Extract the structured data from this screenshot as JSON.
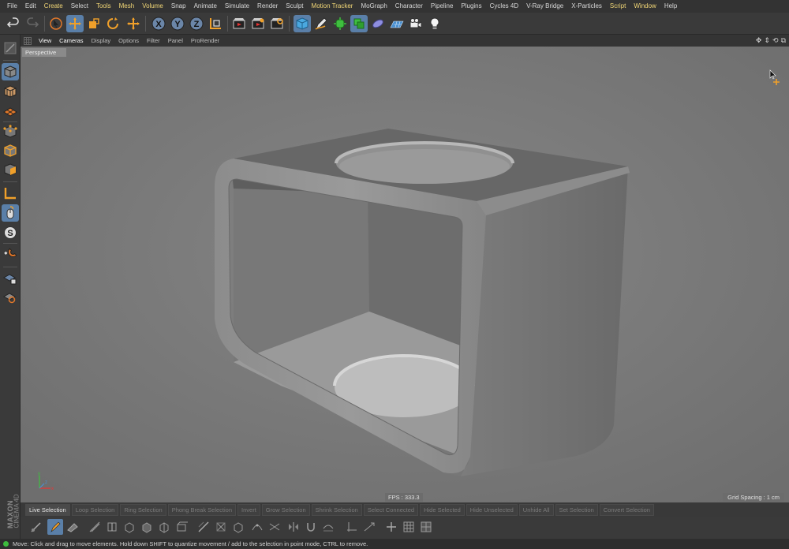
{
  "menu": {
    "items": [
      {
        "label": "File",
        "hl": false
      },
      {
        "label": "Edit",
        "hl": false
      },
      {
        "label": "Create",
        "hl": true
      },
      {
        "label": "Select",
        "hl": false
      },
      {
        "label": "Tools",
        "hl": true
      },
      {
        "label": "Mesh",
        "hl": true
      },
      {
        "label": "Volume",
        "hl": true
      },
      {
        "label": "Snap",
        "hl": false
      },
      {
        "label": "Animate",
        "hl": false
      },
      {
        "label": "Simulate",
        "hl": false
      },
      {
        "label": "Render",
        "hl": false
      },
      {
        "label": "Sculpt",
        "hl": false
      },
      {
        "label": "Motion Tracker",
        "hl": true
      },
      {
        "label": "MoGraph",
        "hl": false
      },
      {
        "label": "Character",
        "hl": false
      },
      {
        "label": "Pipeline",
        "hl": false
      },
      {
        "label": "Plugins",
        "hl": false
      },
      {
        "label": "Cycles 4D",
        "hl": false
      },
      {
        "label": "V-Ray Bridge",
        "hl": false
      },
      {
        "label": "X-Particles",
        "hl": false
      },
      {
        "label": "Script",
        "hl": true
      },
      {
        "label": "Window",
        "hl": true
      },
      {
        "label": "Help",
        "hl": false
      }
    ]
  },
  "viewport_menu": {
    "items": [
      "View",
      "Cameras",
      "Display",
      "Options",
      "Filter",
      "Panel",
      "ProRender"
    ],
    "active": [
      "View",
      "Cameras"
    ]
  },
  "viewport": {
    "label": "Perspective",
    "fps": "FPS : 333.3",
    "grid_spacing": "Grid Spacing : 1 cm"
  },
  "modes": [
    {
      "label": "Live Selection",
      "active": true
    },
    {
      "label": "Loop Selection",
      "active": false
    },
    {
      "label": "Ring Selection",
      "active": false
    },
    {
      "label": "Phong Break Selection",
      "active": false
    },
    {
      "label": "Invert",
      "active": false
    },
    {
      "label": "Grow Selection",
      "active": false
    },
    {
      "label": "Shrink Selection",
      "active": false
    },
    {
      "label": "Select Connected",
      "active": false
    },
    {
      "label": "Hide Selected",
      "active": false
    },
    {
      "label": "Hide Unselected",
      "active": false
    },
    {
      "label": "Unhide All",
      "active": false
    },
    {
      "label": "Set Selection",
      "active": false
    },
    {
      "label": "Convert Selection",
      "active": false
    }
  ],
  "brand": {
    "line1": "MAXON",
    "line2": "CINEMA 4D"
  },
  "status": {
    "text": "Move: Click and drag to move elements. Hold down SHIFT to quantize movement / add to the selection in point mode, CTRL to remove."
  },
  "toolbar_icons": [
    "undo-icon",
    "redo-icon",
    "live-selection-icon",
    "move-icon",
    "scale-icon",
    "rotate-icon",
    "recent-tool-icon",
    "x-axis-icon",
    "y-axis-icon",
    "z-axis-icon",
    "coordinate-system-icon",
    "render-view-icon",
    "render-picture-viewer-icon",
    "edit-render-settings-icon",
    "cube-icon",
    "pen-icon",
    "subdivision-icon",
    "array-icon",
    "deformer-icon",
    "floor-icon",
    "camera-icon",
    "light-icon"
  ],
  "colors": {
    "accent": "#f1d676",
    "selected": "#5a7fa8",
    "viewport_bg": "#7a7a7a",
    "status_ok": "#3dbb3d"
  }
}
